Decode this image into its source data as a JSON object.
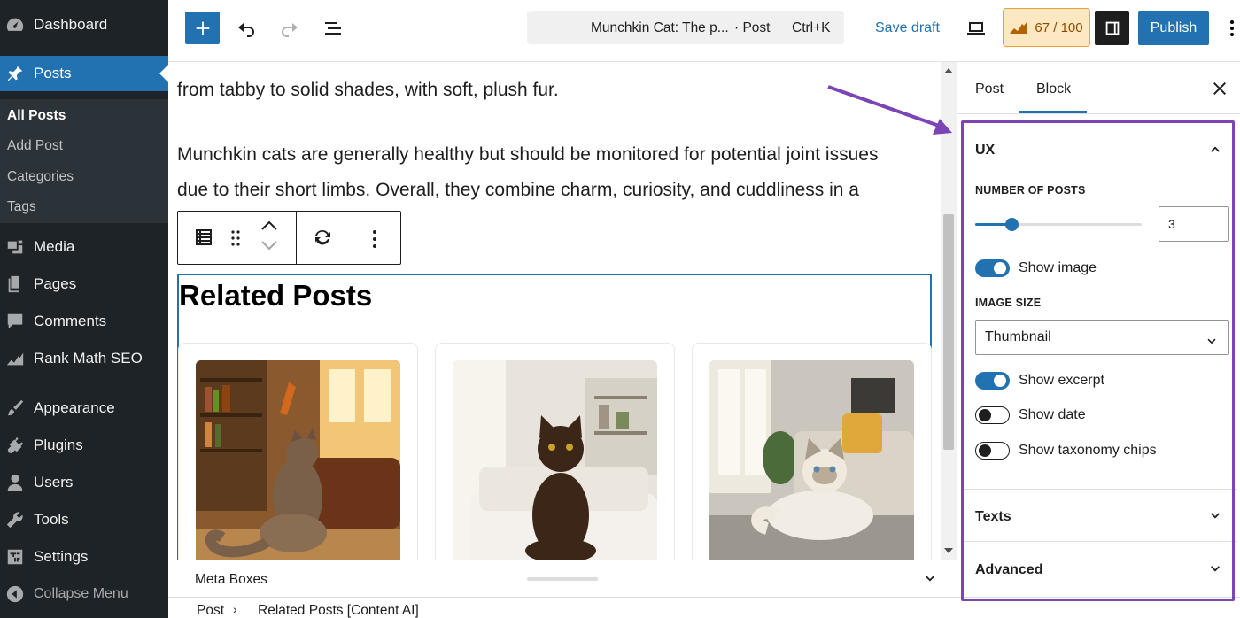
{
  "colors": {
    "accent": "#2271b1",
    "sidebar_bg": "#1d2327",
    "highlight": "#7b45b5",
    "score_bg": "#fde8c2"
  },
  "admin_menu": {
    "items": [
      {
        "label": "Dashboard",
        "icon": "dashboard-icon"
      },
      {
        "label": "Posts",
        "icon": "pushpin-icon"
      },
      {
        "label": "Media",
        "icon": "media-icon"
      },
      {
        "label": "Pages",
        "icon": "pages-icon"
      },
      {
        "label": "Comments",
        "icon": "comments-icon"
      },
      {
        "label": "Rank Math SEO",
        "icon": "rank-math-icon"
      },
      {
        "label": "Appearance",
        "icon": "brush-icon"
      },
      {
        "label": "Plugins",
        "icon": "plugin-icon"
      },
      {
        "label": "Users",
        "icon": "user-icon"
      },
      {
        "label": "Tools",
        "icon": "wrench-icon"
      },
      {
        "label": "Settings",
        "icon": "settings-icon"
      },
      {
        "label": "Collapse Menu",
        "icon": "collapse-icon"
      }
    ],
    "posts_submenu": [
      "All Posts",
      "Add Post",
      "Categories",
      "Tags"
    ]
  },
  "toolbar": {
    "doc_title": "Munchkin Cat: The p...",
    "doc_type": "· Post",
    "shortcut": "Ctrl+K",
    "save_draft": "Save draft",
    "score": "67 / 100",
    "publish": "Publish"
  },
  "content": {
    "para1": "from tabby to solid shades, with soft, plush fur.",
    "para2_line1": "Munchkin cats are generally healthy but should be monitored for potential joint issues",
    "para2_line2": "due to their short limbs. Overall, they combine charm, curiosity, and cuddliness in a",
    "related_heading": "Related Posts"
  },
  "meta_boxes": {
    "label": "Meta Boxes"
  },
  "breadcrumb": {
    "root": "Post",
    "current": "Related Posts [Content AI]"
  },
  "settings": {
    "tabs": [
      "Post",
      "Block"
    ],
    "ux": {
      "title": "UX",
      "number_of_posts_label": "NUMBER OF POSTS",
      "number_of_posts": "3",
      "slider_fraction": 0.22,
      "show_image": {
        "label": "Show image",
        "on": true
      },
      "image_size_label": "IMAGE SIZE",
      "image_size": "Thumbnail",
      "show_excerpt": {
        "label": "Show excerpt",
        "on": true
      },
      "show_date": {
        "label": "Show date",
        "on": false
      },
      "show_taxonomy": {
        "label": "Show taxonomy chips",
        "on": false
      }
    },
    "texts_title": "Texts",
    "advanced_title": "Advanced"
  }
}
